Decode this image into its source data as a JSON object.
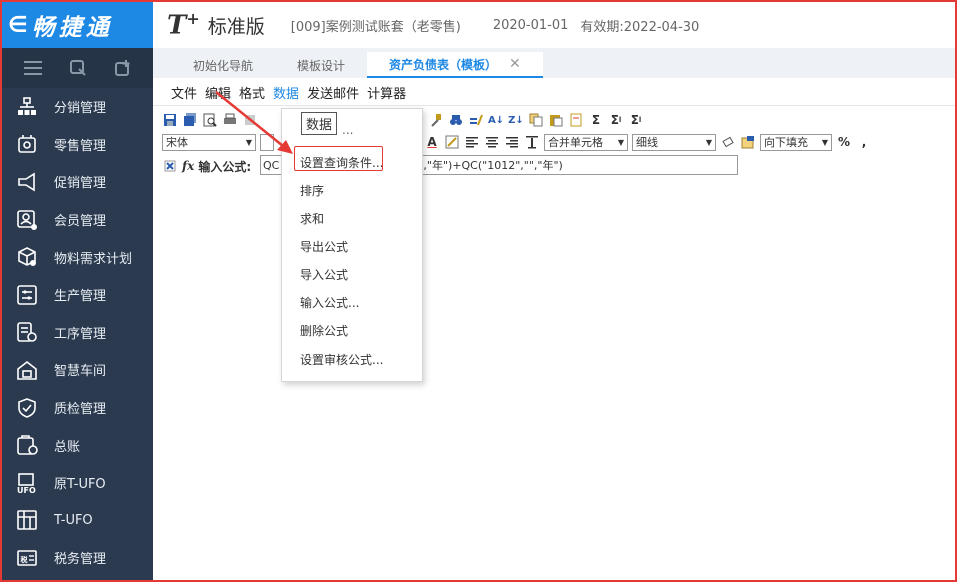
{
  "brand": {
    "back_glyph": "∈",
    "name": "畅捷通"
  },
  "sidebar": {
    "tools": [
      "menu-icon",
      "search-icon",
      "add-icon"
    ],
    "items": [
      {
        "label": "分销管理",
        "icon": "org-chart-icon"
      },
      {
        "label": "零售管理",
        "icon": "retail-icon"
      },
      {
        "label": "促销管理",
        "icon": "megaphone-icon"
      },
      {
        "label": "会员管理",
        "icon": "member-icon"
      },
      {
        "label": "物料需求计划",
        "icon": "material-icon"
      },
      {
        "label": "生产管理",
        "icon": "production-icon"
      },
      {
        "label": "工序管理",
        "icon": "process-icon"
      },
      {
        "label": "智慧车间",
        "icon": "workshop-icon"
      },
      {
        "label": "质检管理",
        "icon": "quality-icon"
      },
      {
        "label": "总账",
        "icon": "ledger-icon"
      },
      {
        "label": "原T-UFO",
        "icon": "ufo-icon"
      },
      {
        "label": "T-UFO",
        "icon": "tufo-icon"
      },
      {
        "label": "税务管理",
        "icon": "tax-icon"
      }
    ]
  },
  "header": {
    "logo": "T",
    "logo_sup": "+",
    "edition": "标准版",
    "account": "[009]案例测试账套（老零售)",
    "date": "2020-01-01",
    "valid": "有效期:2022-04-30"
  },
  "tabs": [
    {
      "label": "初始化导航",
      "active": false
    },
    {
      "label": "模板设计",
      "active": false
    },
    {
      "label": "资产负债表（模板）",
      "active": true,
      "close": "✕"
    }
  ],
  "menubar": [
    "文件",
    "编辑",
    "格式",
    "数据",
    "发送邮件",
    "计算器"
  ],
  "toolbar2": {
    "font": "宋体",
    "merge": "合并单元格",
    "line": "细线",
    "fill": "向下填充",
    "percent": "%",
    "comma": ","
  },
  "formula": {
    "label": "输入公式:",
    "value_left": "QC",
    "value_right": "\",\"年\")+QC(\"1012\",\"\",\"年\")"
  },
  "tooltip": "数据",
  "dropdown": {
    "items": [
      "设置查询条件...",
      "排序",
      "求和",
      "导出公式",
      "导入公式",
      "输入公式...",
      "删除公式",
      "设置审核公式..."
    ],
    "partial_first": "..."
  },
  "colors": {
    "brand_blue": "#1e88e5",
    "sidebar_bg": "#2b3a4f",
    "annotation_red": "#e53935"
  }
}
